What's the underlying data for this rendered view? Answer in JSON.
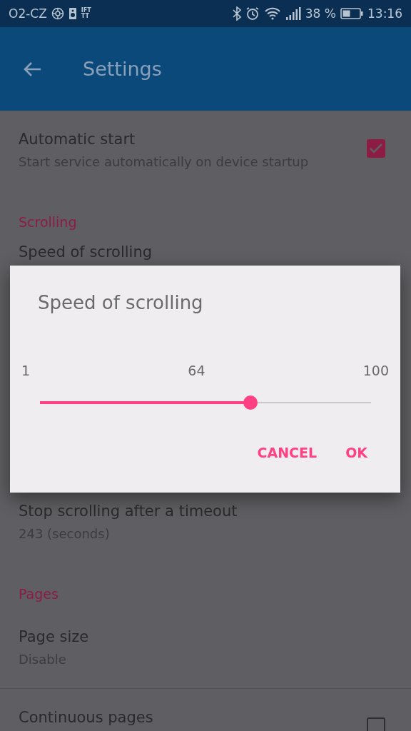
{
  "status_bar": {
    "carrier": "O2-CZ",
    "app_badge": "IFTTT",
    "battery": "38 %",
    "time": "13:16"
  },
  "app_bar": {
    "title": "Settings"
  },
  "preferences_above": [
    {
      "kind": "checkbox",
      "title": "Automatic start",
      "summary": "Start service automatically on device startup",
      "checked": true
    },
    {
      "kind": "header",
      "title": "Scrolling"
    },
    {
      "kind": "item",
      "title": "Speed of scrolling"
    }
  ],
  "preferences_below": [
    {
      "kind": "item",
      "title": "Stop scrolling after a timeout",
      "summary": "243 (seconds)"
    },
    {
      "kind": "header",
      "title": "Pages"
    },
    {
      "kind": "item",
      "title": "Page size",
      "summary": "Disable",
      "divider": true
    },
    {
      "kind": "checkbox",
      "title": "Continuous pages",
      "checked": false
    }
  ],
  "dialog": {
    "title": "Speed of scrolling",
    "min": "1",
    "value": "64",
    "max": "100",
    "level": 0.636,
    "buttons": [
      "CANCEL",
      "OK"
    ]
  }
}
